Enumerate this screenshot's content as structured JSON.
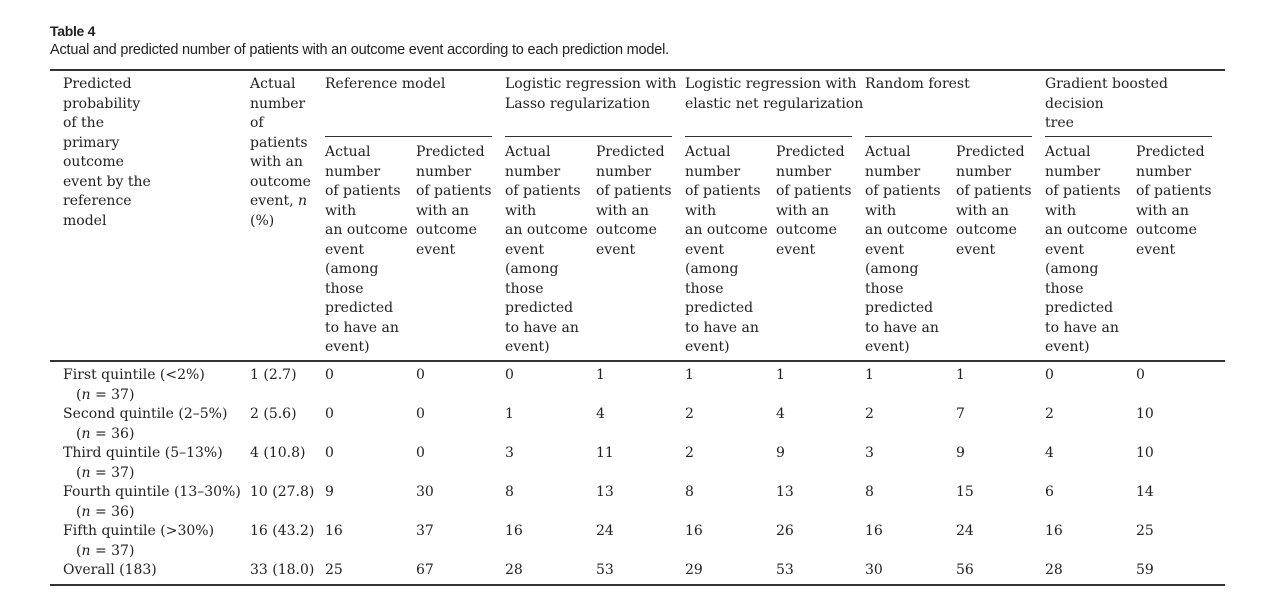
{
  "table": {
    "label": "Table 4",
    "title": "Actual and predicted number of patients with an outcome event according to each prediction model.",
    "header": {
      "col1": "Predicted\nprobability\nof the\nprimary\noutcome\nevent by the\nreference\nmodel",
      "col2_main": "Actual\nnumber\nof\npatients\nwith an\noutcome\nevent, ",
      "col2_n": "n",
      "col2_tail": "\n(%)",
      "models": [
        "Reference model",
        "Logistic regression with\nLasso regularization",
        "Logistic regression with\nelastic net regularization",
        "Random forest",
        "Gradient boosted\ndecision\ntree"
      ],
      "sub_actual": "Actual\nnumber\nof patients\nwith\nan outcome\nevent\n(among\nthose\npredicted\nto have an\nevent)",
      "sub_predicted": "Predicted\nnumber\nof patients\nwith an\noutcome\nevent"
    },
    "rows": [
      {
        "label": "First quintile (<2%)",
        "n": "(n = 37)",
        "actual": "1 (2.7)",
        "values": [
          "0",
          "0",
          "0",
          "1",
          "1",
          "1",
          "1",
          "1",
          "0",
          "0"
        ]
      },
      {
        "label": "Second quintile (2–5%)",
        "n": "(n = 36)",
        "actual": "2 (5.6)",
        "values": [
          "0",
          "0",
          "1",
          "4",
          "2",
          "4",
          "2",
          "7",
          "2",
          "10"
        ]
      },
      {
        "label": "Third quintile (5–13%)",
        "n": "(n = 37)",
        "actual": "4 (10.8)",
        "values": [
          "0",
          "0",
          "3",
          "11",
          "2",
          "9",
          "3",
          "9",
          "4",
          "10"
        ]
      },
      {
        "label": "Fourth quintile (13–30%)",
        "n": "(n = 36)",
        "actual": "10 (27.8)",
        "values": [
          "9",
          "30",
          "8",
          "13",
          "8",
          "13",
          "8",
          "15",
          "6",
          "14"
        ]
      },
      {
        "label": "Fifth quintile (>30%)",
        "n": "(n = 37)",
        "actual": "16 (43.2)",
        "values": [
          "16",
          "37",
          "16",
          "24",
          "16",
          "26",
          "16",
          "24",
          "16",
          "25"
        ]
      },
      {
        "label": "Overall (183)",
        "n": "",
        "actual": "33 (18.0)",
        "values": [
          "25",
          "67",
          "28",
          "53",
          "29",
          "53",
          "30",
          "56",
          "28",
          "59"
        ]
      }
    ]
  }
}
